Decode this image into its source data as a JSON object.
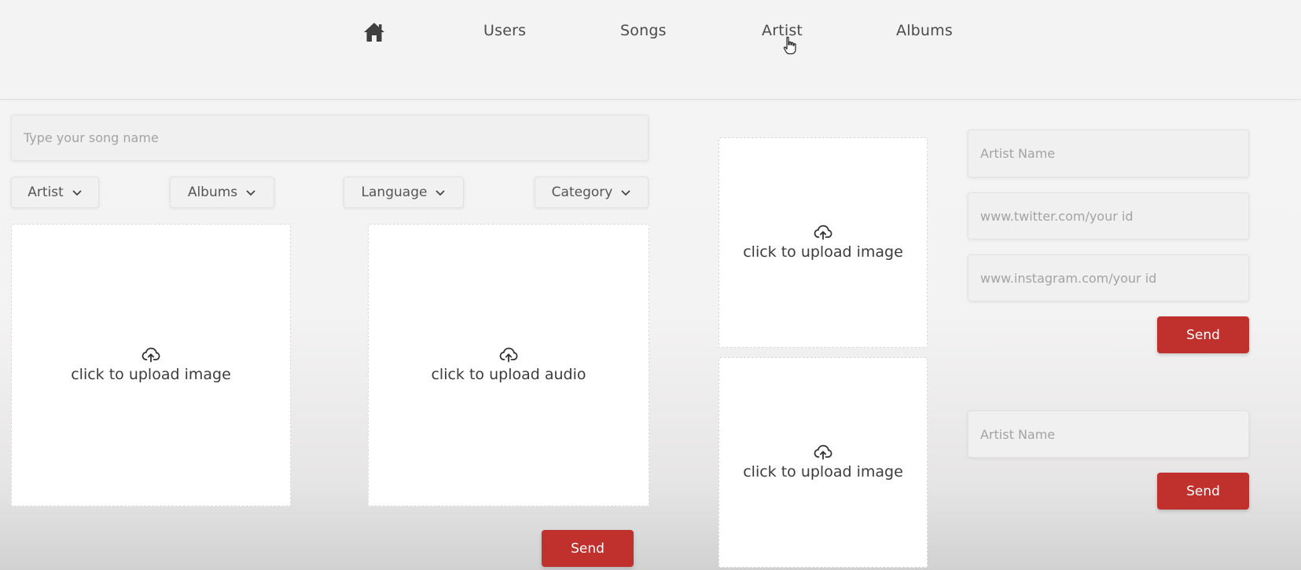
{
  "nav": {
    "home_icon": "home-icon",
    "items": [
      "Users",
      "Songs",
      "Artist",
      "Albums"
    ]
  },
  "song_form": {
    "name_placeholder": "Type your song name",
    "filters": [
      "Artist",
      "Albums",
      "Language",
      "Category"
    ],
    "image_upload_label": "click to upload image",
    "audio_upload_label": "click to upload audio",
    "upload_icon": "cloud-upload-icon",
    "send_label": "Send"
  },
  "artist_form": {
    "image_upload_label": "click to upload image",
    "name_placeholder": "Artist Name",
    "twitter_placeholder": "www.twitter.com/your id",
    "instagram_placeholder": "www.instagram.com/your id",
    "send_label": "Send"
  },
  "album_form": {
    "image_upload_label": "click to upload image",
    "name_placeholder": "Artist Name",
    "send_label": "Send"
  },
  "colors": {
    "accent": "#c0302c",
    "background": "#f4f3f3"
  }
}
